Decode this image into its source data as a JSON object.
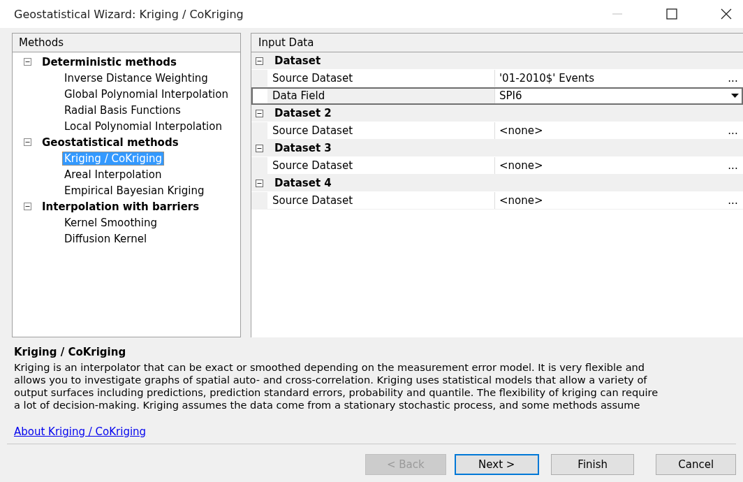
{
  "window": {
    "title": "Geostatistical Wizard: Kriging / CoKriging"
  },
  "methods": {
    "header": "Methods",
    "groups": [
      {
        "label": "Deterministic methods",
        "expanded": true,
        "children": [
          {
            "label": "Inverse Distance Weighting",
            "selected": false
          },
          {
            "label": "Global Polynomial Interpolation",
            "selected": false
          },
          {
            "label": "Radial Basis Functions",
            "selected": false
          },
          {
            "label": "Local Polynomial Interpolation",
            "selected": false
          }
        ]
      },
      {
        "label": "Geostatistical methods",
        "expanded": true,
        "children": [
          {
            "label": "Kriging / CoKriging",
            "selected": true
          },
          {
            "label": "Areal Interpolation",
            "selected": false
          },
          {
            "label": "Empirical Bayesian Kriging",
            "selected": false
          }
        ]
      },
      {
        "label": "Interpolation with barriers",
        "expanded": true,
        "children": [
          {
            "label": "Kernel Smoothing",
            "selected": false
          },
          {
            "label": "Diffusion Kernel",
            "selected": false
          }
        ]
      }
    ]
  },
  "input_data": {
    "header": "Input Data",
    "categories": [
      {
        "label": "Dataset",
        "expanded": true,
        "properties": [
          {
            "name": "Source Dataset",
            "value": "'01-2010$' Events",
            "kind": "ellipsis",
            "button": "...",
            "selected": false
          },
          {
            "name": "Data Field",
            "value": "SPI6",
            "kind": "dropdown",
            "selected": true
          }
        ]
      },
      {
        "label": "Dataset 2",
        "expanded": true,
        "properties": [
          {
            "name": "Source Dataset",
            "value": "<none>",
            "kind": "ellipsis",
            "button": "...",
            "selected": false
          }
        ]
      },
      {
        "label": "Dataset 3",
        "expanded": true,
        "properties": [
          {
            "name": "Source Dataset",
            "value": "<none>",
            "kind": "ellipsis",
            "button": "...",
            "selected": false
          }
        ]
      },
      {
        "label": "Dataset 4",
        "expanded": true,
        "properties": [
          {
            "name": "Source Dataset",
            "value": "<none>",
            "kind": "ellipsis",
            "button": "...",
            "selected": false
          }
        ]
      }
    ]
  },
  "description": {
    "title": "Kriging / CoKriging",
    "lines": [
      "Kriging is an interpolator that can be exact or smoothed depending on the measurement error model. It is very flexible and",
      "allows you to investigate graphs of spatial auto- and cross-correlation. Kriging uses statistical models that allow a variety of",
      "output surfaces including predictions, prediction standard errors, probability and quantile. The flexibility of kriging can require",
      "a lot of decision-making. Kriging assumes the data come from a stationary stochastic process, and some methods assume"
    ],
    "link": "About Kriging / CoKriging"
  },
  "buttons": [
    {
      "label": "< Back",
      "disabled": true,
      "default": false
    },
    {
      "label": "Next >",
      "disabled": false,
      "default": true
    },
    {
      "label": "Finish",
      "disabled": false,
      "default": false
    },
    {
      "label": "Cancel",
      "disabled": false,
      "default": false
    }
  ]
}
